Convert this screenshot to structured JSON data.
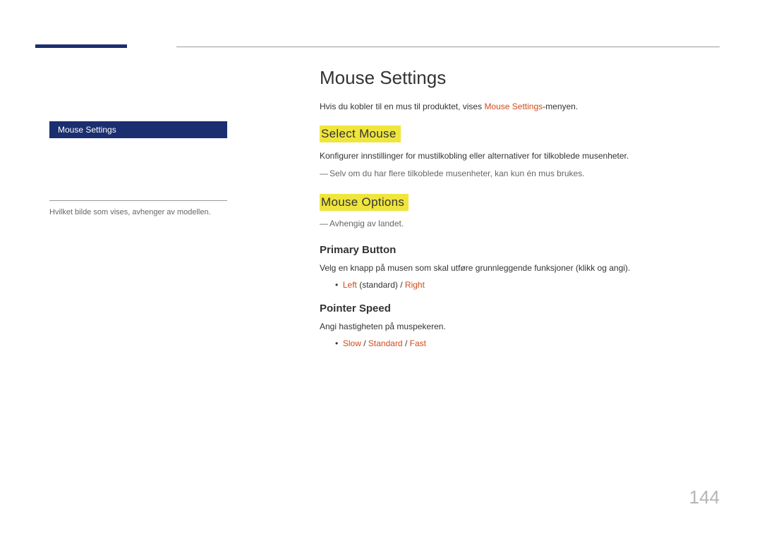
{
  "sidebar": {
    "item_label": "Mouse Settings",
    "note": "Hvilket bilde som vises, avhenger av modellen."
  },
  "content": {
    "title": "Mouse Settings",
    "intro_pre": "Hvis du kobler til en mus til produktet, vises ",
    "intro_ref": "Mouse Settings",
    "intro_post": "-menyen.",
    "select_mouse": {
      "heading": "Select Mouse",
      "body": "Konfigurer innstillinger for mustilkobling eller alternativer for tilkoblede musenheter.",
      "note": "Selv om du har flere tilkoblede musenheter, kan kun én mus brukes."
    },
    "mouse_options": {
      "heading": "Mouse Options",
      "note": "Avhengig av landet.",
      "primary_button": {
        "heading": "Primary Button",
        "body": "Velg en knapp på musen som skal utføre grunnleggende funksjoner (klikk og angi).",
        "opt1": "Left",
        "opt1_suffix": " (standard) / ",
        "opt2": "Right"
      },
      "pointer_speed": {
        "heading": "Pointer Speed",
        "body": "Angi hastigheten på muspekeren.",
        "opt1": "Slow",
        "sep1": " / ",
        "opt2": "Standard",
        "sep2": " / ",
        "opt3": "Fast"
      }
    }
  },
  "page_number": "144"
}
